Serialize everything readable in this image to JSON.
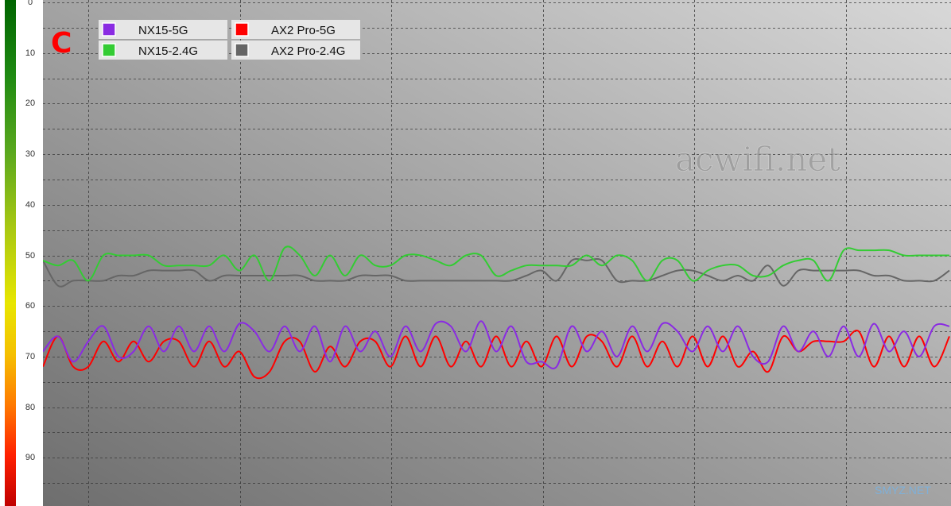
{
  "panel_letter": "C",
  "watermark": "acwifi.net",
  "site_mark": "SMYZ.NET",
  "chart_data": {
    "type": "line",
    "ylim": [
      0,
      100
    ],
    "y_inverted": true,
    "yticks": [
      0,
      10,
      20,
      30,
      40,
      50,
      60,
      70,
      80,
      90,
      100
    ],
    "ytick_labels": [
      "0",
      "10",
      "20",
      "30",
      "40",
      "50",
      "60",
      "70",
      "80",
      "90",
      ""
    ],
    "xlim": [
      0,
      60
    ],
    "grid": true,
    "legend_position": "top-left",
    "series": [
      {
        "name": "NX15-5G",
        "color": "#8a2be2",
        "values": [
          69,
          66,
          71,
          67,
          64,
          70,
          69,
          64,
          69,
          64,
          69,
          64,
          69,
          63.5,
          65,
          69,
          64,
          69,
          64,
          71,
          64,
          69,
          65,
          70,
          64,
          69,
          63.5,
          64,
          69,
          63,
          69,
          64,
          71,
          71,
          72,
          64,
          69,
          65,
          70,
          64,
          69,
          63.5,
          65,
          69,
          64,
          69,
          64,
          70,
          71,
          64,
          69,
          65,
          70,
          64,
          70,
          63.5,
          69,
          65,
          70,
          64,
          64
        ]
      },
      {
        "name": "NX15-2.4G",
        "color": "#33cc33",
        "values": [
          51,
          52,
          51,
          55,
          50,
          50,
          50,
          50,
          52,
          52,
          52,
          52,
          50,
          53,
          50,
          55,
          48.5,
          50,
          54,
          50,
          54,
          50,
          52,
          52,
          50,
          50,
          51,
          52,
          50,
          50,
          54,
          53,
          52,
          52,
          52,
          52,
          50,
          52,
          50,
          51,
          55,
          51,
          51,
          55,
          53,
          52,
          52,
          54,
          54,
          52,
          51,
          51,
          55,
          49,
          49,
          49,
          49,
          50,
          50,
          50,
          50
        ]
      },
      {
        "name": "AX2 Pro-5G",
        "color": "#ff0000",
        "values": [
          72,
          66,
          72,
          72,
          67,
          71,
          67,
          71,
          67,
          67,
          72,
          67,
          72,
          69,
          74,
          73,
          67,
          67,
          73,
          68,
          72,
          67,
          67,
          72,
          66,
          72,
          66,
          72,
          67,
          72,
          66,
          72,
          67,
          72,
          66,
          72,
          66,
          67,
          72,
          66,
          72,
          67,
          72,
          66,
          72,
          66,
          72,
          69,
          73,
          66,
          69,
          67,
          67,
          67,
          65,
          72,
          66,
          72,
          66,
          72,
          66
        ]
      },
      {
        "name": "AX2 Pro-2.4G",
        "color": "#666666",
        "values": [
          51,
          56,
          55,
          55,
          55,
          54,
          54,
          53,
          53,
          53,
          53,
          55,
          54,
          54,
          54,
          54,
          54,
          54,
          55,
          55,
          55,
          54,
          54,
          54,
          55,
          55,
          55,
          55,
          55,
          55,
          55,
          55,
          54,
          53,
          55,
          51,
          51,
          51,
          55,
          55,
          55,
          54,
          53,
          53,
          54,
          55,
          54,
          55,
          52,
          56,
          53,
          53,
          53,
          53,
          53,
          54,
          54,
          55,
          55,
          55,
          53
        ]
      }
    ]
  }
}
